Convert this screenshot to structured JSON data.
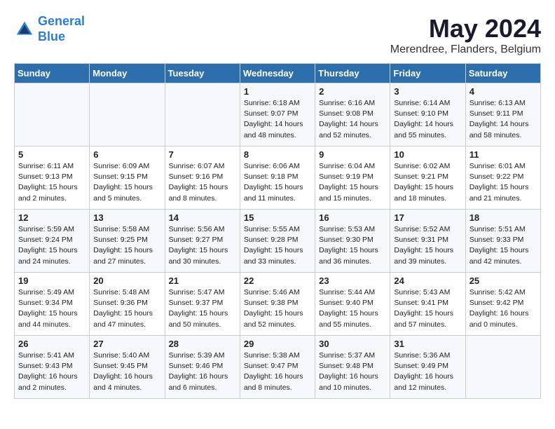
{
  "logo": {
    "line1": "General",
    "line2": "Blue"
  },
  "title": "May 2024",
  "location": "Merendree, Flanders, Belgium",
  "days_of_week": [
    "Sunday",
    "Monday",
    "Tuesday",
    "Wednesday",
    "Thursday",
    "Friday",
    "Saturday"
  ],
  "weeks": [
    [
      {
        "num": "",
        "info": ""
      },
      {
        "num": "",
        "info": ""
      },
      {
        "num": "",
        "info": ""
      },
      {
        "num": "1",
        "info": "Sunrise: 6:18 AM\nSunset: 9:07 PM\nDaylight: 14 hours\nand 48 minutes."
      },
      {
        "num": "2",
        "info": "Sunrise: 6:16 AM\nSunset: 9:08 PM\nDaylight: 14 hours\nand 52 minutes."
      },
      {
        "num": "3",
        "info": "Sunrise: 6:14 AM\nSunset: 9:10 PM\nDaylight: 14 hours\nand 55 minutes."
      },
      {
        "num": "4",
        "info": "Sunrise: 6:13 AM\nSunset: 9:11 PM\nDaylight: 14 hours\nand 58 minutes."
      }
    ],
    [
      {
        "num": "5",
        "info": "Sunrise: 6:11 AM\nSunset: 9:13 PM\nDaylight: 15 hours\nand 2 minutes."
      },
      {
        "num": "6",
        "info": "Sunrise: 6:09 AM\nSunset: 9:15 PM\nDaylight: 15 hours\nand 5 minutes."
      },
      {
        "num": "7",
        "info": "Sunrise: 6:07 AM\nSunset: 9:16 PM\nDaylight: 15 hours\nand 8 minutes."
      },
      {
        "num": "8",
        "info": "Sunrise: 6:06 AM\nSunset: 9:18 PM\nDaylight: 15 hours\nand 11 minutes."
      },
      {
        "num": "9",
        "info": "Sunrise: 6:04 AM\nSunset: 9:19 PM\nDaylight: 15 hours\nand 15 minutes."
      },
      {
        "num": "10",
        "info": "Sunrise: 6:02 AM\nSunset: 9:21 PM\nDaylight: 15 hours\nand 18 minutes."
      },
      {
        "num": "11",
        "info": "Sunrise: 6:01 AM\nSunset: 9:22 PM\nDaylight: 15 hours\nand 21 minutes."
      }
    ],
    [
      {
        "num": "12",
        "info": "Sunrise: 5:59 AM\nSunset: 9:24 PM\nDaylight: 15 hours\nand 24 minutes."
      },
      {
        "num": "13",
        "info": "Sunrise: 5:58 AM\nSunset: 9:25 PM\nDaylight: 15 hours\nand 27 minutes."
      },
      {
        "num": "14",
        "info": "Sunrise: 5:56 AM\nSunset: 9:27 PM\nDaylight: 15 hours\nand 30 minutes."
      },
      {
        "num": "15",
        "info": "Sunrise: 5:55 AM\nSunset: 9:28 PM\nDaylight: 15 hours\nand 33 minutes."
      },
      {
        "num": "16",
        "info": "Sunrise: 5:53 AM\nSunset: 9:30 PM\nDaylight: 15 hours\nand 36 minutes."
      },
      {
        "num": "17",
        "info": "Sunrise: 5:52 AM\nSunset: 9:31 PM\nDaylight: 15 hours\nand 39 minutes."
      },
      {
        "num": "18",
        "info": "Sunrise: 5:51 AM\nSunset: 9:33 PM\nDaylight: 15 hours\nand 42 minutes."
      }
    ],
    [
      {
        "num": "19",
        "info": "Sunrise: 5:49 AM\nSunset: 9:34 PM\nDaylight: 15 hours\nand 44 minutes."
      },
      {
        "num": "20",
        "info": "Sunrise: 5:48 AM\nSunset: 9:36 PM\nDaylight: 15 hours\nand 47 minutes."
      },
      {
        "num": "21",
        "info": "Sunrise: 5:47 AM\nSunset: 9:37 PM\nDaylight: 15 hours\nand 50 minutes."
      },
      {
        "num": "22",
        "info": "Sunrise: 5:46 AM\nSunset: 9:38 PM\nDaylight: 15 hours\nand 52 minutes."
      },
      {
        "num": "23",
        "info": "Sunrise: 5:44 AM\nSunset: 9:40 PM\nDaylight: 15 hours\nand 55 minutes."
      },
      {
        "num": "24",
        "info": "Sunrise: 5:43 AM\nSunset: 9:41 PM\nDaylight: 15 hours\nand 57 minutes."
      },
      {
        "num": "25",
        "info": "Sunrise: 5:42 AM\nSunset: 9:42 PM\nDaylight: 16 hours\nand 0 minutes."
      }
    ],
    [
      {
        "num": "26",
        "info": "Sunrise: 5:41 AM\nSunset: 9:43 PM\nDaylight: 16 hours\nand 2 minutes."
      },
      {
        "num": "27",
        "info": "Sunrise: 5:40 AM\nSunset: 9:45 PM\nDaylight: 16 hours\nand 4 minutes."
      },
      {
        "num": "28",
        "info": "Sunrise: 5:39 AM\nSunset: 9:46 PM\nDaylight: 16 hours\nand 6 minutes."
      },
      {
        "num": "29",
        "info": "Sunrise: 5:38 AM\nSunset: 9:47 PM\nDaylight: 16 hours\nand 8 minutes."
      },
      {
        "num": "30",
        "info": "Sunrise: 5:37 AM\nSunset: 9:48 PM\nDaylight: 16 hours\nand 10 minutes."
      },
      {
        "num": "31",
        "info": "Sunrise: 5:36 AM\nSunset: 9:49 PM\nDaylight: 16 hours\nand 12 minutes."
      },
      {
        "num": "",
        "info": ""
      }
    ]
  ]
}
